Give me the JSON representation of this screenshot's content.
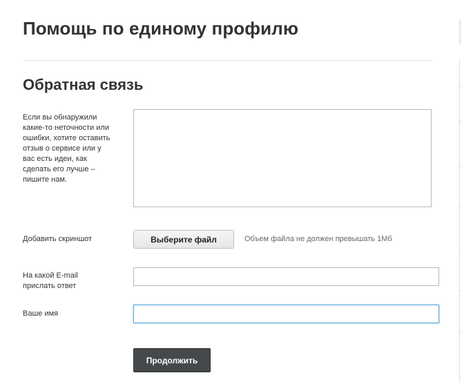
{
  "header": {
    "title": "Помощь по единому профилю"
  },
  "feedback": {
    "title": "Обратная связь",
    "description_label": "Если вы обнаружили какие-то неточности или ошибки, хотите оставить отзыв о сервисе или у вас есть идеи, как сделать его лучше – пишите нам.",
    "message_value": "",
    "screenshot_label": "Добавить скриншот",
    "file_button_label": "Выберите файл",
    "file_hint": "Объем файла не должен превышать 1Мб",
    "email_label": "На какой E-mail прислать ответ",
    "email_value": "",
    "name_label": "Ваше имя",
    "name_value": "",
    "submit_label": "Продолжить"
  },
  "colors": {
    "submit_background": "#46494c",
    "focus_border": "#5aa6d6",
    "text": "#333333"
  }
}
